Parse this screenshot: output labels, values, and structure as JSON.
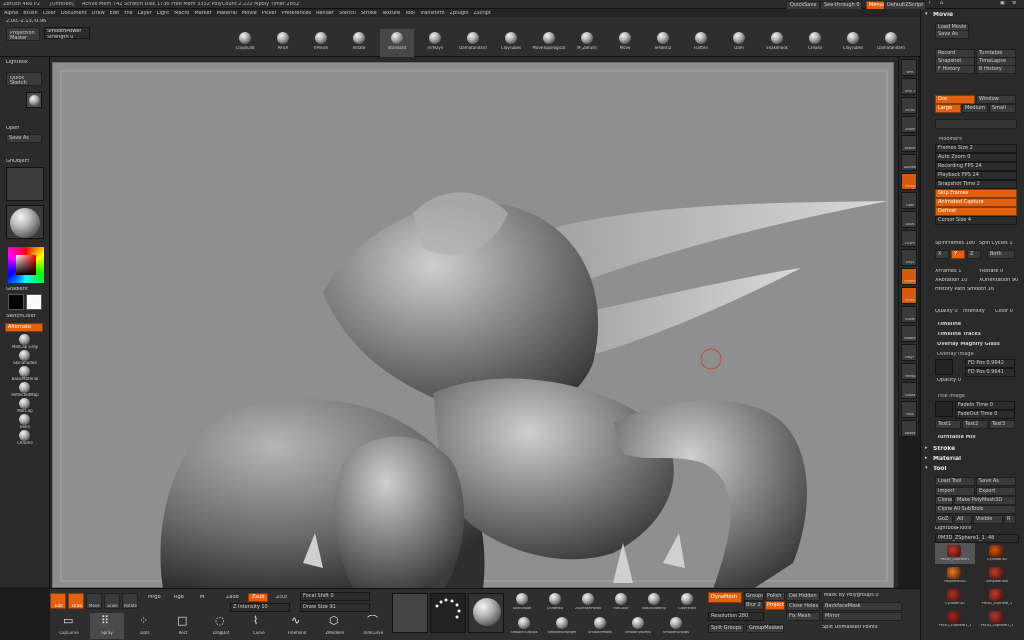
{
  "title_bar": {
    "app": "ZBrush 4R6 P2",
    "doc": "[Untitled]",
    "status": "Active Mem 742  Scratch Disk 1736  Free Mem 3352  PolyCount 2.222 Mpoly  Timer 2852",
    "quicksave": "QuickSave",
    "see_through": "See-through 0",
    "menus_btn": "Menus",
    "script": "DefaultZScript",
    "icons": [
      "?",
      "⌂",
      "▣",
      "⚙"
    ]
  },
  "menu_bar": [
    "Alpha",
    "Brush",
    "Color",
    "Document",
    "Draw",
    "Edit",
    "File",
    "Layer",
    "Light",
    "Macro",
    "Marker",
    "Material",
    "Movie",
    "Picker",
    "Preferences",
    "Render",
    "Stencil",
    "Stroke",
    "Texture",
    "Tool",
    "Transform",
    "Zplugin",
    "Zscript"
  ],
  "readout": "2.00,-2.13,-0.96",
  "projection_master": "Projection Master",
  "strength": {
    "label": "SmoothPower",
    "sub": "Strength 0"
  },
  "brush_shelf": [
    {
      "label": "ClayBuild"
    },
    {
      "label": "Pinch"
    },
    {
      "label": "hPolish"
    },
    {
      "label": "Inflate"
    },
    {
      "label": "Standard"
    },
    {
      "label": "TrimDyn"
    },
    {
      "label": "DamStandard"
    },
    {
      "label": "ClayTubes"
    },
    {
      "label": "MoveTopological"
    },
    {
      "label": "M_ZBrush"
    },
    {
      "label": "Move"
    },
    {
      "label": "hPolish2"
    },
    {
      "label": "Flatten"
    },
    {
      "label": "Dam"
    },
    {
      "label": "Snakehook"
    },
    {
      "label": "Crease"
    },
    {
      "label": "ClayTubes"
    },
    {
      "label": "DamStandard"
    }
  ],
  "left_tray": {
    "lightbox": "LightBox",
    "quick_sketch": "Quick Sketch",
    "open": "Open",
    "save_as": "Save As",
    "ghost": "GhObject",
    "gradient": "Gradient",
    "switch_color": "SwitchColor",
    "alternate": "Alternate",
    "materials": [
      "MatCap Gray",
      "SkinShade4",
      "BasicMaterial",
      "ReflectedMap",
      "MatCap",
      "Blinn",
      "Chrome"
    ]
  },
  "right_icons": [
    "BPR",
    "SPix 3",
    "Scroll",
    "Zoom",
    "Actual",
    "AAHalf",
    "Persp",
    "Floor",
    "Local",
    "LSym",
    "Gxyz",
    "Frame",
    "Move",
    "Scale",
    "Rotate",
    "PolyF",
    "Transp",
    "Ghost",
    "Solo",
    "Xpose"
  ],
  "movie_panel": {
    "header": "Movie",
    "load_movie": "Load Movie",
    "save_as": "Save As",
    "record": "Record",
    "turntable": "Turntable",
    "snapshot": "Snapshot",
    "timelapse": "TimeLapse",
    "history": "F History",
    "b_history": "B History",
    "doc": "Doc",
    "window": "Window",
    "large": "Large",
    "medium": "Medium",
    "small": "Small",
    "modifiers": "Modifiers",
    "frame_size": "Frames Size 2",
    "auto_zoom": "Auto Zoom 0",
    "recording_fps": "Recording FPS 24",
    "playback_fps": "Playback FPS 24",
    "snapshot_time": "Snapshot Time 2",
    "skip_frames": "Skip Frames",
    "animated_capture": "Animated Capture",
    "defrost": "Defrost",
    "cursor_size": "Cursor Size 4",
    "spin_frames": "SpinFrames 180",
    "spin_cycles": "Spin Cycles 1",
    "axis": [
      "X",
      "Y",
      "Z"
    ],
    "both": "Both",
    "x_frames": "XFrames 1",
    "y_rotate": "YRotate 0",
    "x_rotation": "XRotation 10",
    "x_orientation": "XOrientation 90",
    "history_smooth": "History Path Smooth 16",
    "quality": "Quality 0",
    "intensity": "Intensity",
    "color": "Color 0",
    "timeline": "Timeline",
    "timeline_tracks": "Timeline Tracks",
    "overlay_magnify": "Overlay Magnify Glass",
    "overlay_image": "Overlay Image",
    "fd_pos": "FD Pos 0.9642",
    "fd_pos2": "FD Pos 0.9641",
    "opacity": "Opacity 0",
    "title_image": "Title Image",
    "fade_in": "FadeIn Time 0",
    "fade_out": "FadeOut Time 0",
    "text1": "Text1",
    "text2": "Text2",
    "text3": "Text3",
    "turntable_mix": "Turntable Mix"
  },
  "lower_right": {
    "stroke": "Stroke",
    "material": "Material",
    "tool": "Tool",
    "load_tool": "Load Tool",
    "save_as": "Save As",
    "import": "Import",
    "export": "Export",
    "clone": "Clone",
    "make_polymesh": "Make PolyMesh3D",
    "clone_all": "Clone All SubTools",
    "goz": "GoZ",
    "all": "All",
    "visible": "Visible",
    "r": "R",
    "lightbox_tools": "Lightbox▸Tools",
    "tool_name": "PM3D_ZSphere1_1. 48",
    "tools": [
      "PM3D_ZSphere1",
      "Cylinder3D",
      "PolyMesh3D",
      "SimpleBrush",
      "Cylinder3D",
      "PM3D_ZSphere_1",
      "PM3D_ZSphere1_1",
      "PM3D_ZSphere1_1"
    ]
  },
  "bottom_bar": {
    "edit": "Edit",
    "draw": "Draw",
    "move": "Move",
    "scale": "Scale",
    "rotate": "Rotate",
    "mrgb": "Mrgb",
    "rgb": "Rgb",
    "m": "M",
    "zadd": "Zadd",
    "zsub": "Zsub",
    "zcut": "Zcut",
    "focal_shift": "Focal Shift 0",
    "draw_size": "Draw Size 91",
    "z_intensity": "Z Intensity 10",
    "tools": [
      "ClipCurve",
      "Spray",
      "Dots",
      "Rect",
      "DragDot",
      "Curve",
      "Freehand",
      "ZModeler",
      "TrimCurve"
    ],
    "materials": [
      "SkinShade",
      "ChromeA",
      "ZSurfacePolish",
      "FlatColor",
      "BasicShading",
      "ClayFinish"
    ],
    "material_labels2": [
      "Smooth Groups",
      "SmoothStronger",
      "SmoothPeaks",
      "SmoothValleys",
      "SmoothGroups"
    ],
    "dynamesh": "DynaMesh",
    "groups": "Groups",
    "polish": "Polish 1",
    "blur": "Blur 2",
    "project": "Project",
    "resolution": "Resolution 280",
    "split_groups": "Split Groups",
    "group_masked": "GroupMasked",
    "del_hidden": "Del Hidden",
    "close_holes": "Close Holes",
    "fix_mesh": "Fix Mesh",
    "mask_polygroup": "Mask By Polygroups 0",
    "backface": "BackfaceMask",
    "mirror": "Mirror",
    "split_unmasked": "Split Unmasked Points"
  }
}
